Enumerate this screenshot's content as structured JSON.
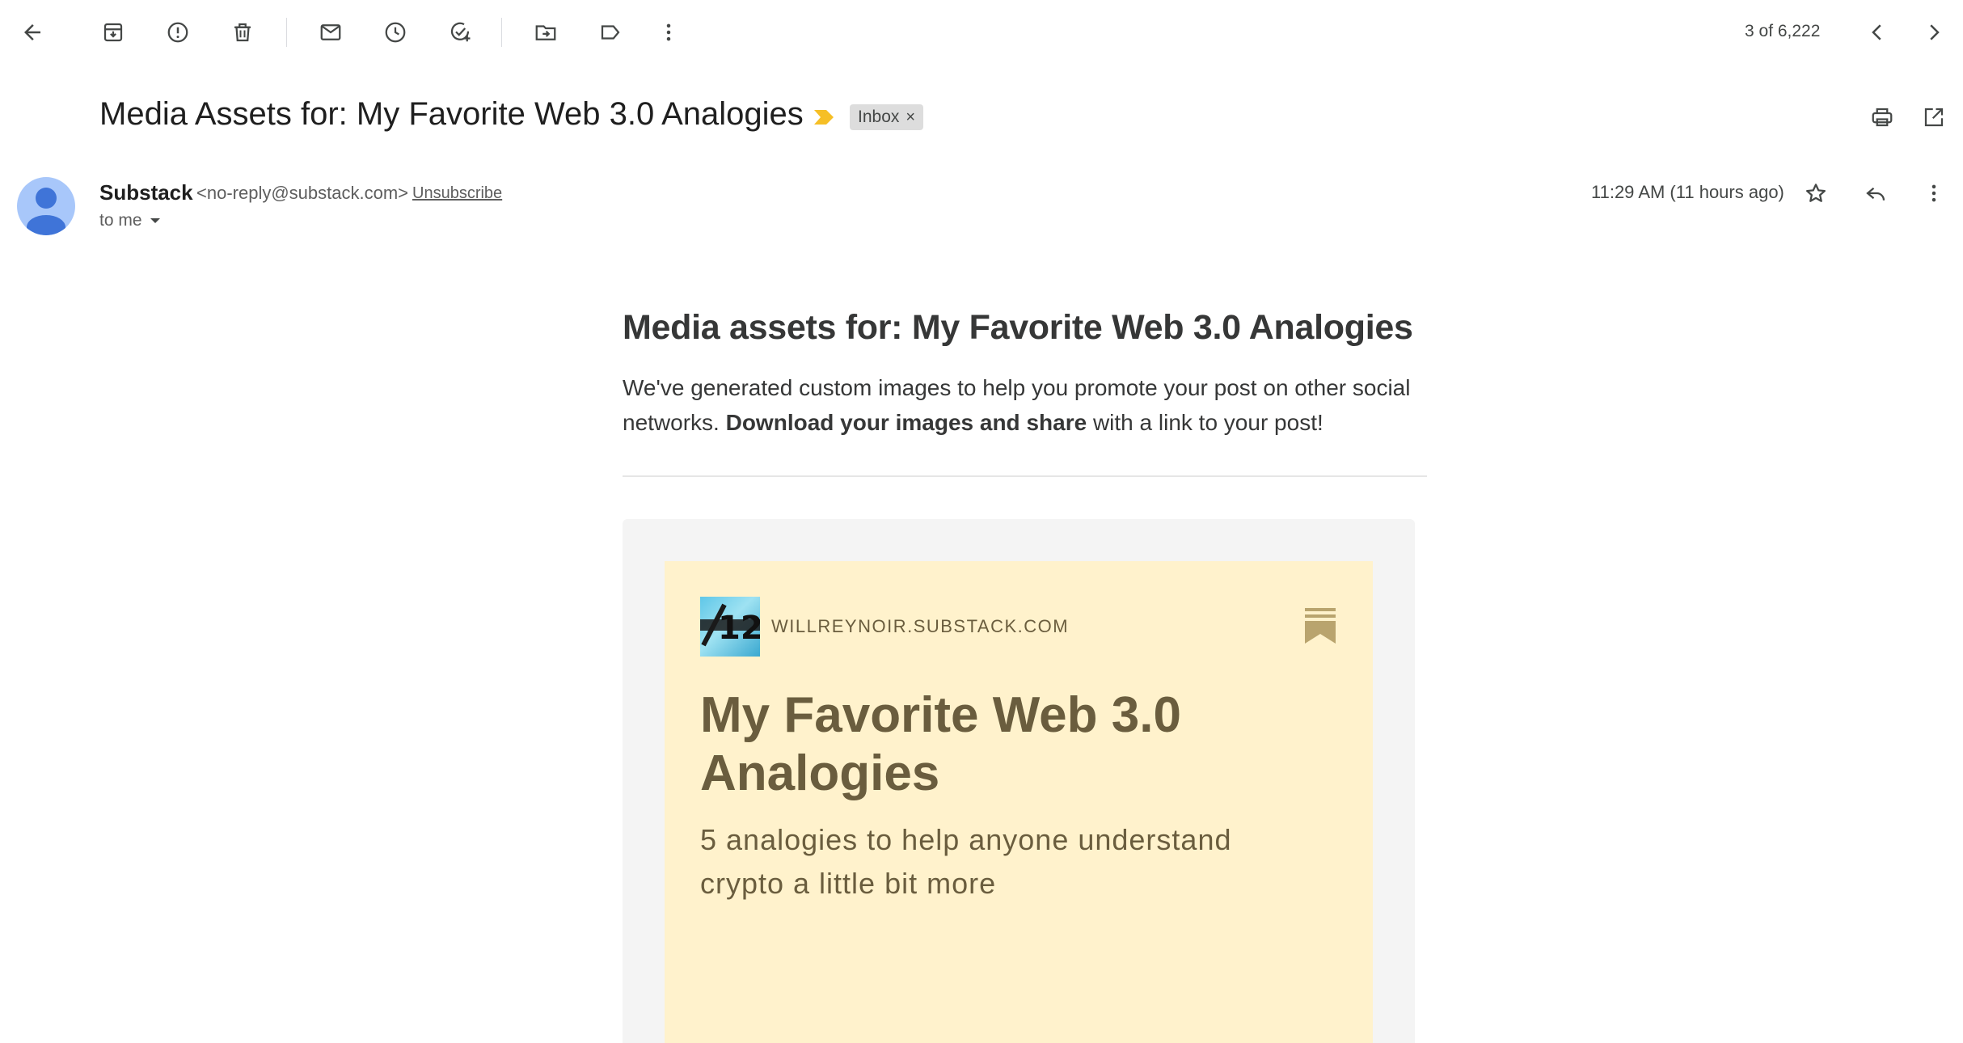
{
  "toolbar": {
    "pager": "3 of 6,222",
    "icons": [
      "back-arrow-icon",
      "archive-icon",
      "report-spam-icon",
      "delete-icon",
      "mark-unread-icon",
      "snooze-icon",
      "add-task-icon",
      "move-to-icon",
      "label-icon",
      "more-vert-icon",
      "chevron-left-icon",
      "chevron-right-icon"
    ]
  },
  "subject": {
    "title": "Media Assets for: My Favorite Web 3.0 Analogies",
    "label": "Inbox",
    "label_remove": "×",
    "importance_color": "#f6bf26"
  },
  "sender": {
    "name": "Substack",
    "email": "<no-reply@substack.com>",
    "unsubscribe": "Unsubscribe",
    "to": "to me",
    "time": "11:29 AM (11 hours ago)"
  },
  "message": {
    "heading": "Media assets for: My Favorite Web 3.0 Analogies",
    "intro_before": "We've generated custom images to help you promote your post on other social networks. ",
    "intro_bold": "Download your images and share",
    "intro_after": " with a link to your post!"
  },
  "card": {
    "logo_text": "12",
    "domain": "WILLREYNOIR.SUBSTACK.COM",
    "title": "My Favorite Web 3.0 Analogies",
    "subtitle": "5 analogies to help anyone understand crypto a little bit more",
    "background": "#fff2cc",
    "text_color": "#6a5d3e"
  }
}
